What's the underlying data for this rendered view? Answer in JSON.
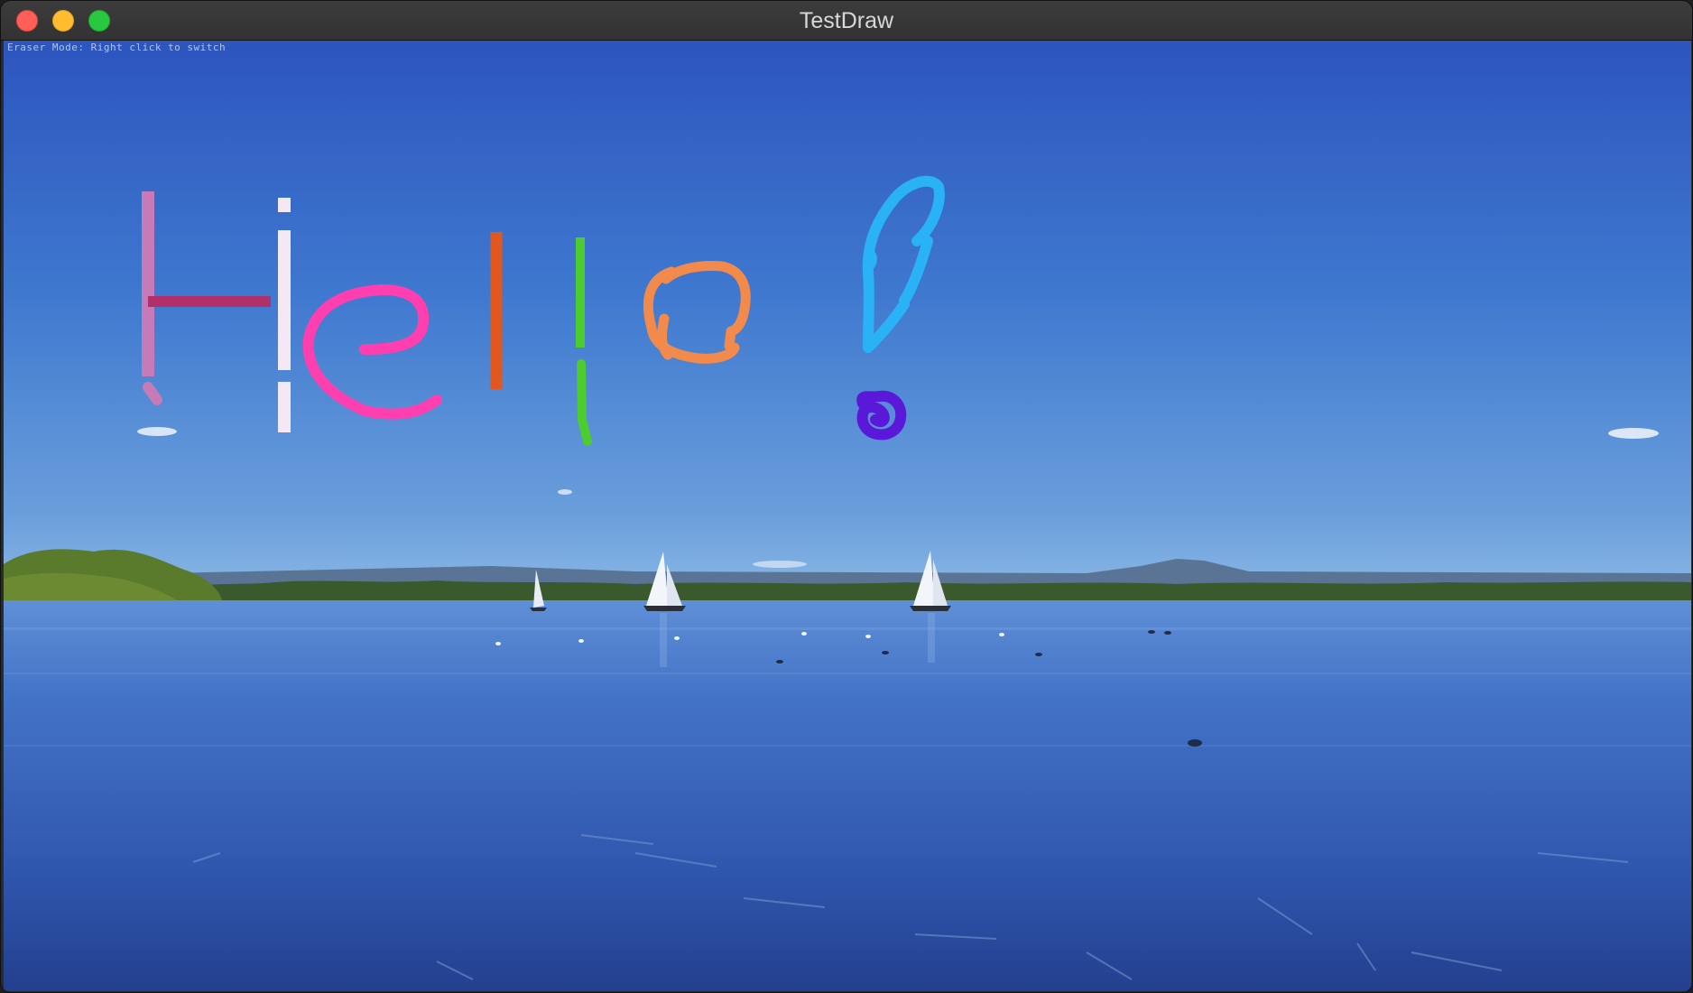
{
  "window": {
    "title": "TestDraw"
  },
  "canvas": {
    "mode_hint": "Eraser Mode: Right click to switch",
    "background_image": "lake-with-sailboats-under-blue-sky",
    "strokes": [
      {
        "name": "H-left-stroke",
        "color": "#c77ab8"
      },
      {
        "name": "H-crossbar-stroke",
        "color": "#b0306a"
      },
      {
        "name": "H-right-stroke",
        "color": "#f4e8f4"
      },
      {
        "name": "e-stroke",
        "color": "#ff3fb0"
      },
      {
        "name": "l-first-stroke",
        "color": "#e0581e"
      },
      {
        "name": "l-second-stroke",
        "color": "#4ccc2e"
      },
      {
        "name": "o-stroke",
        "color": "#f18a4a"
      },
      {
        "name": "exclamation-stroke",
        "color": "#29b2f5"
      },
      {
        "name": "exclamation-dot-stroke",
        "color": "#5a18d8"
      }
    ]
  }
}
